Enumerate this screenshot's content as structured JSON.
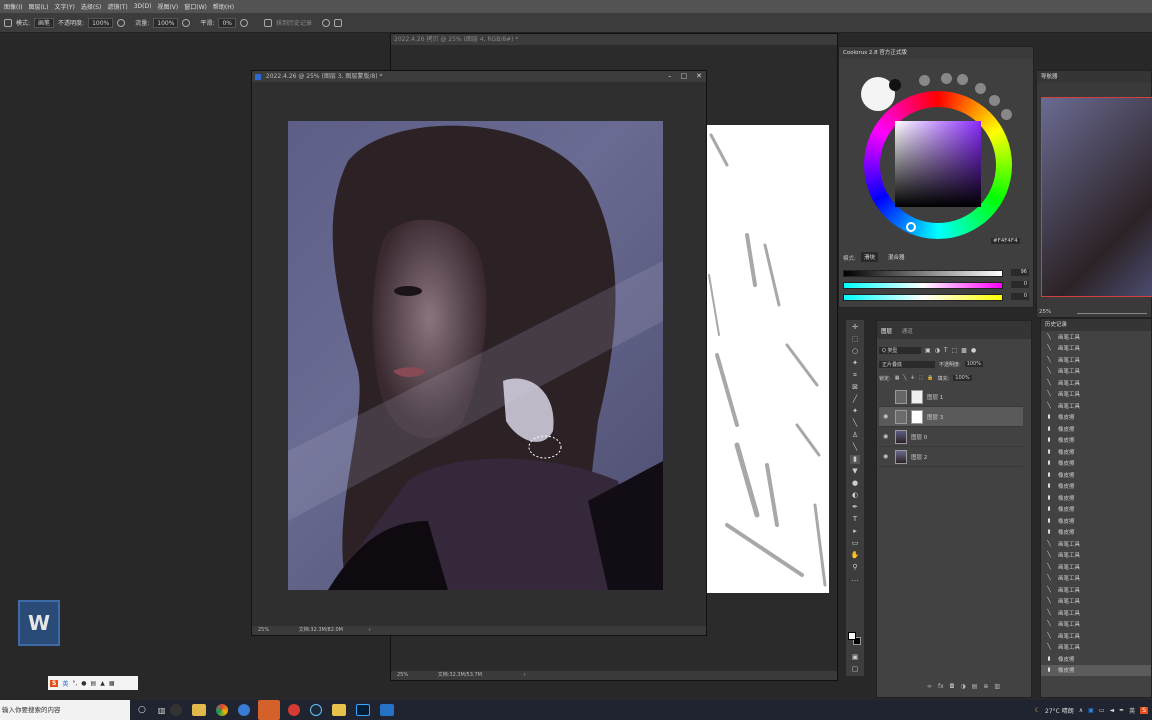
{
  "menu": {
    "items": [
      "图像(I)",
      "图层(L)",
      "文字(Y)",
      "选择(S)",
      "滤镜(T)",
      "3D(D)",
      "视图(V)",
      "窗口(W)",
      "帮助(H)"
    ]
  },
  "options": {
    "mode_label": "模式:",
    "mode_value": "画笔",
    "opacity_label": "不透明度:",
    "opacity_value": "100%",
    "flow_label": "流量:",
    "flow_value": "100%",
    "smooth_label": "平滑:",
    "smooth_value": "0%",
    "history_label": "抹到历史记录"
  },
  "back_window": {
    "title": "2022.4.26 拷贝 @ 25% (图层 4, RGB/8#) *",
    "zoom": "25%",
    "doc_info": "文档:32.3M/53.7M"
  },
  "front_window": {
    "title": "2022.4.26 @ 25% (图层 3, 图层蒙版/8) *",
    "zoom": "25%",
    "doc_info": "文档:32.3M/82.0M"
  },
  "color_panel": {
    "title": "Coolorus 2.8 官方正式版",
    "hex": "#F4F4F4",
    "mode_label": "模式:",
    "tab_slider": "滑块",
    "tab_mixer": "混合器",
    "sliders": [
      {
        "value": "96"
      },
      {
        "value": "0"
      },
      {
        "value": "0"
      }
    ]
  },
  "navigator": {
    "title": "导航器",
    "zoom": "25%"
  },
  "layers_panel": {
    "tab_layers": "图层",
    "tab_channels": "通道",
    "filter_label": "Q 类型",
    "blend_mode": "正片叠底",
    "opacity_label": "不透明度:",
    "opacity_value": "100%",
    "lock_label": "锁定:",
    "fill_label": "填充:",
    "fill_value": "100%",
    "layers": [
      {
        "name": "图层 1",
        "visible": false,
        "selected": false
      },
      {
        "name": "图层 3",
        "visible": true,
        "selected": true
      },
      {
        "name": "图层 0",
        "visible": true,
        "selected": false
      },
      {
        "name": "图层 2",
        "visible": true,
        "selected": false
      }
    ]
  },
  "history_panel": {
    "title": "历史记录",
    "items": [
      "画笔工具",
      "画笔工具",
      "画笔工具",
      "画笔工具",
      "画笔工具",
      "画笔工具",
      "画笔工具",
      "橡皮擦",
      "橡皮擦",
      "橡皮擦",
      "橡皮擦",
      "橡皮擦",
      "橡皮擦",
      "橡皮擦",
      "橡皮擦",
      "橡皮擦",
      "橡皮擦",
      "橡皮擦",
      "画笔工具",
      "画笔工具",
      "画笔工具",
      "画笔工具",
      "画笔工具",
      "画笔工具",
      "画笔工具",
      "画笔工具",
      "画笔工具",
      "画笔工具",
      "橡皮擦",
      "橡皮擦"
    ]
  },
  "taskbar": {
    "search_placeholder": "输入你要搜索的内容",
    "weather": "27°C 晴朗",
    "ime": "英"
  },
  "ime_bar": {
    "label": "英"
  },
  "colors": {
    "ps_bg": "#282828",
    "panel": "#424242",
    "accent_red": "#d04040",
    "taskbar": "#1f2430"
  }
}
